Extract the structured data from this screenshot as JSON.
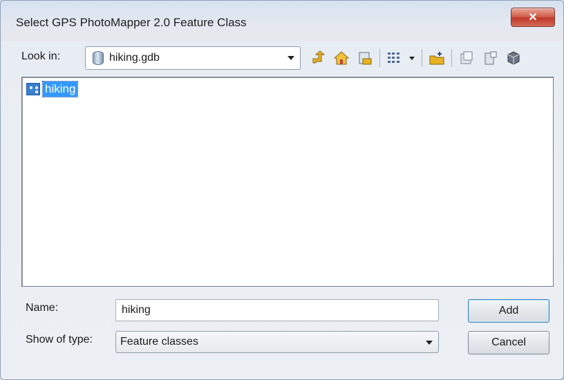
{
  "window": {
    "title": "Select GPS PhotoMapper 2.0 Feature Class",
    "close_glyph": "✕"
  },
  "look_in": {
    "label": "Look in:",
    "value": "hiking.gdb",
    "icon": "geodatabase-icon"
  },
  "toolbar": {
    "icons": [
      "up-one-level-icon",
      "home-icon",
      "connect-folder-icon",
      "view-menu-icon",
      "new-folder-icon",
      "copy-icon",
      "delete-icon",
      "database-connect-icon"
    ]
  },
  "list": {
    "items": [
      {
        "label": "hiking",
        "icon": "feature-class-icon",
        "selected": true
      }
    ]
  },
  "name": {
    "label": "Name:",
    "value": "hiking"
  },
  "show_type": {
    "label": "Show of type:",
    "value": "Feature classes"
  },
  "buttons": {
    "add": "Add",
    "cancel": "Cancel"
  },
  "colors": {
    "selection": "#3399ff",
    "close_button": "#c0392b"
  }
}
